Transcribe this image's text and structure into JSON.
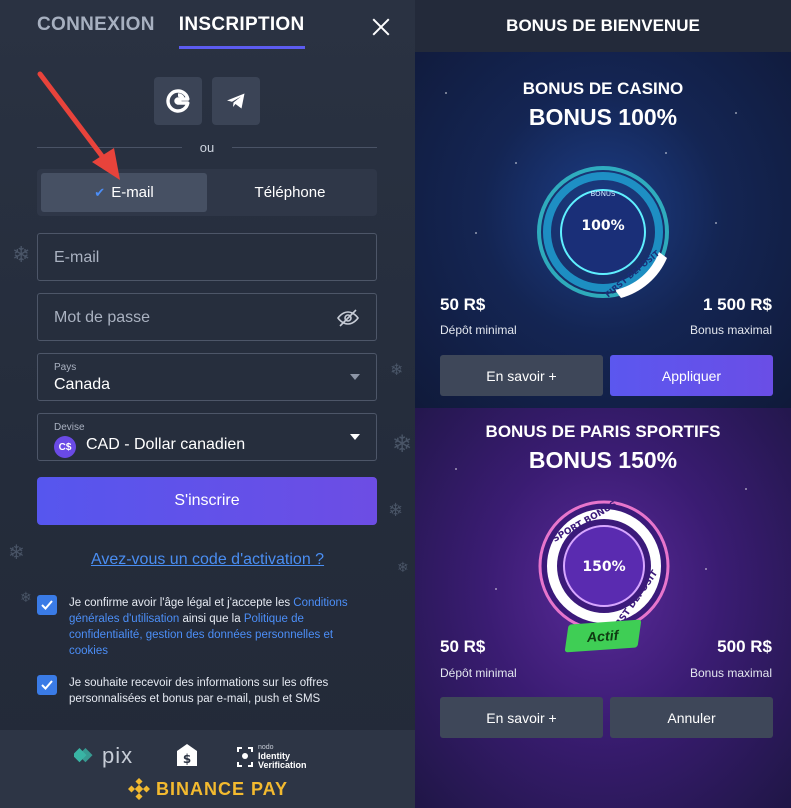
{
  "left": {
    "tabs": {
      "login": "CONNEXION",
      "register": "INSCRIPTION"
    },
    "divider_text": "ou",
    "method": {
      "email": "E-mail",
      "phone": "Téléphone"
    },
    "fields": {
      "email_placeholder": "E-mail",
      "password_placeholder": "Mot de passe",
      "country_label": "Pays",
      "country_value": "Canada",
      "currency_label": "Devise",
      "currency_badge": "C$",
      "currency_value": "CAD - Dollar canadien"
    },
    "submit_label": "S'inscrire",
    "activation_link": "Avez-vous un code d'activation ?",
    "consent1": {
      "pre": "Je confirme avoir l'âge légal et j'accepte les ",
      "link1": "Conditions générales d'utilisation",
      "mid": " ainsi que la ",
      "link2": "Politique de confidentialité, gestion des données personnelles et cookies"
    },
    "consent2": "Je souhaite recevoir des informations sur les offres personnalisées et bonus par e-mail, push et SMS",
    "payment": {
      "pix": "pix",
      "identity_line1": "nodo",
      "identity_line2": "Identity",
      "identity_line3": "Verification",
      "binance": "BINANCE PAY"
    }
  },
  "right": {
    "header": "BONUS DE BIENVENUE",
    "casino": {
      "title": "BONUS DE CASINO",
      "subtitle": "BONUS 100%",
      "badge_top": "BONUS",
      "badge_percent": "100%",
      "badge_ring": "FIRST DEPOSIT",
      "min_amount": "50 R$",
      "min_label": "Dépôt minimal",
      "max_amount": "1 500 R$",
      "max_label": "Bonus maximal",
      "learn_more": "En savoir +",
      "apply": "Appliquer"
    },
    "sport": {
      "title": "BONUS DE PARIS SPORTIFS",
      "subtitle": "BONUS 150%",
      "badge_top": "SPORT BONUS",
      "badge_percent": "150%",
      "badge_ring": "FIRST DEPOSIT",
      "status": "Actif",
      "min_amount": "50 R$",
      "min_label": "Dépôt minimal",
      "max_amount": "500 R$",
      "max_label": "Bonus maximal",
      "learn_more": "En savoir +",
      "cancel": "Annuler"
    }
  },
  "colors": {
    "accent": "#5c5cf0",
    "link": "#4c8ef7",
    "active_green": "#3fce55",
    "annotation_arrow": "#e8433b"
  }
}
